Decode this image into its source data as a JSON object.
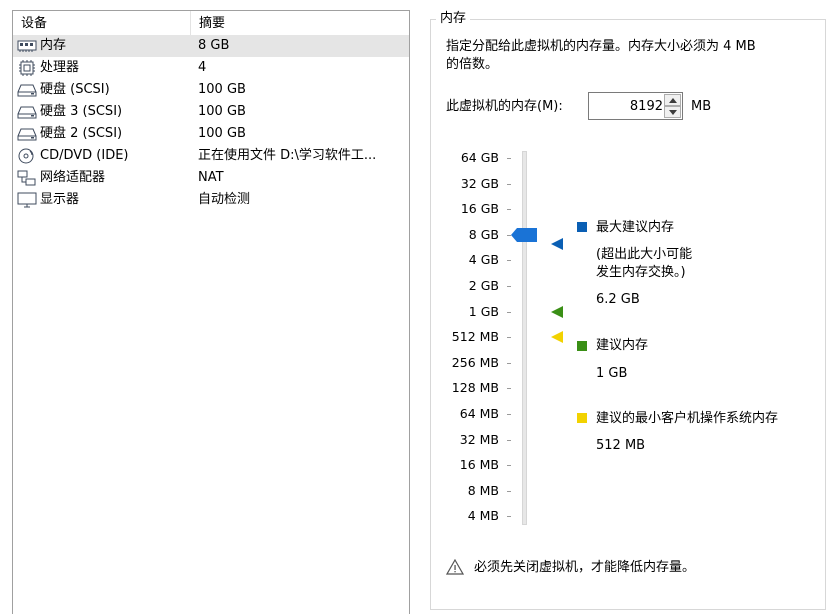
{
  "device_list": {
    "columns": {
      "device": "设备",
      "summary": "摘要"
    },
    "rows": [
      {
        "name": "内存",
        "summary": "8 GB",
        "icon": "memory-icon",
        "selected": true
      },
      {
        "name": "处理器",
        "summary": "4",
        "icon": "processor-icon",
        "selected": false
      },
      {
        "name": "硬盘 (SCSI)",
        "summary": "100 GB",
        "icon": "hard-disk-icon",
        "selected": false
      },
      {
        "name": "硬盘 3 (SCSI)",
        "summary": "100 GB",
        "icon": "hard-disk-icon",
        "selected": false
      },
      {
        "name": "硬盘 2 (SCSI)",
        "summary": "100 GB",
        "icon": "hard-disk-icon",
        "selected": false
      },
      {
        "name": "CD/DVD (IDE)",
        "summary": "正在使用文件 D:\\学习软件工...",
        "icon": "cd-dvd-icon",
        "selected": false
      },
      {
        "name": "网络适配器",
        "summary": "NAT",
        "icon": "network-adapter-icon",
        "selected": false
      },
      {
        "name": "显示器",
        "summary": "自动检测",
        "icon": "display-icon",
        "selected": false
      }
    ]
  },
  "memory": {
    "group_title": "内存",
    "description_line1": "指定分配给此虚拟机的内存量。内存大小必须为 4 MB",
    "description_line2": "的倍数。",
    "field_label": "此虚拟机的内存(M):",
    "value": "8192",
    "unit": "MB",
    "slider": {
      "ticks": [
        "64 GB",
        "32 GB",
        "16 GB",
        "8 GB",
        "4 GB",
        "2 GB",
        "1 GB",
        "512 MB",
        "256 MB",
        "128 MB",
        "64 MB",
        "32 MB",
        "16 MB",
        "8 MB",
        "4 MB"
      ],
      "current": "8 GB",
      "max_recommended": "6.2 GB",
      "recommended": "1 GB",
      "min_guest_os": "512 MB"
    },
    "legend": {
      "max_label": "最大建议内存",
      "max_note_line1": "(超出此大小可能",
      "max_note_line2": "发生内存交换。)",
      "max_value": "6.2 GB",
      "recommended_label": "建议内存",
      "recommended_value": "1 GB",
      "min_label": "建议的最小客户机操作系统内存",
      "min_value": "512 MB"
    },
    "warning": "必须先关闭虚拟机，才能降低内存量。"
  },
  "colors": {
    "max_marker": "#0a5fb4",
    "recommended_marker": "#3a8f16",
    "min_marker": "#f2d200",
    "thumb": "#1a73d6",
    "selected_row": "#e5e5e5"
  }
}
